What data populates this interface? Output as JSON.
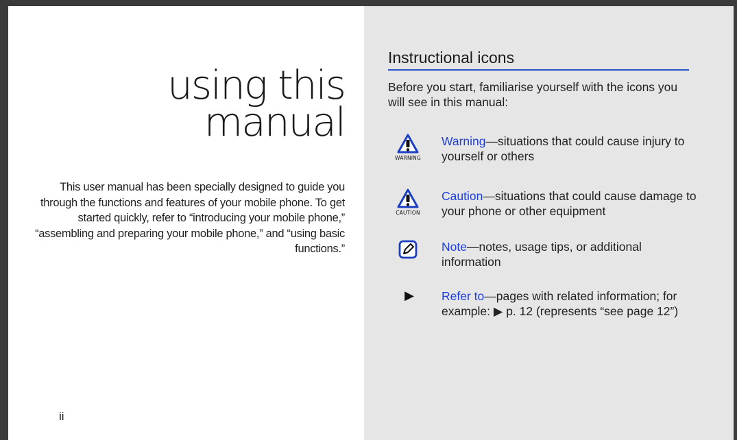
{
  "left_page": {
    "title_line1": "using this",
    "title_line2": "manual",
    "intro": "This user manual has been specially designed to guide you through the functions and features of your mobile phone. To get started quickly, refer to “introducing your mobile phone,” “assembling and preparing your mobile phone,” and “using basic functions.”",
    "page_number": "ii"
  },
  "right_page": {
    "heading": "Instructional icons",
    "intro": "Before you start, familiarise yourself with the icons you will see in this manual:",
    "items": [
      {
        "icon": "warning-triangle-icon",
        "caption": "WARNING",
        "term": "Warning",
        "desc": "situations that could cause injury to yourself or others"
      },
      {
        "icon": "caution-triangle-icon",
        "caption": "CAUTION",
        "term": "Caution",
        "desc": "situations that could cause damage to your phone or other equipment"
      },
      {
        "icon": "note-pencil-icon",
        "caption": "",
        "term": "Note",
        "desc": "notes, usage tips, or additional information"
      },
      {
        "icon": "arrow-right-icon",
        "caption": "",
        "term": "Refer to",
        "desc": "pages with related information; for example: ▶ p. 12 (represents “see page 12”)"
      }
    ],
    "dash": "—"
  },
  "colors": {
    "accent_blue": "#2040d8",
    "rule_blue": "#2a54c9",
    "right_page_bg": "#e6e6e6",
    "frame": "#3a3a3a"
  }
}
